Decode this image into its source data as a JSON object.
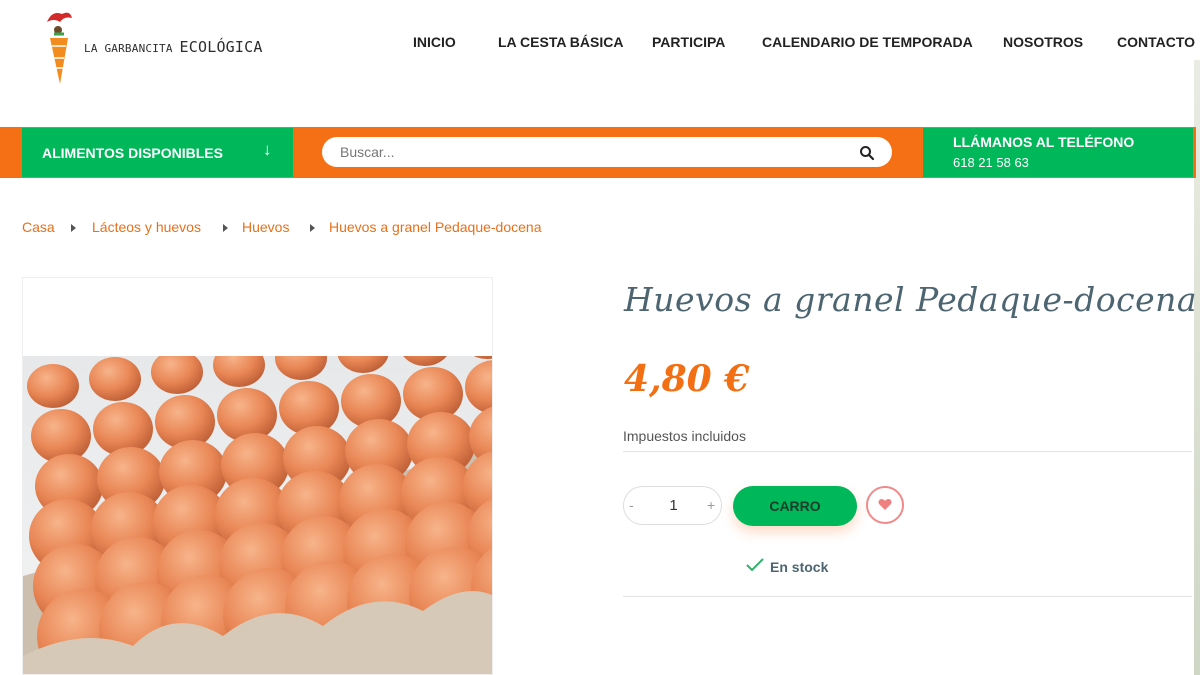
{
  "brand": {
    "line1": "LA GARBANCITA",
    "line2": "ECOLÓGICA"
  },
  "nav": [
    "INICIO",
    "LA CESTA BÁSICA",
    "PARTICIPA",
    "CALENDARIO DE TEMPORADA",
    "NOSOTROS",
    "CONTACTO"
  ],
  "category_button": {
    "label": "ALIMENTOS DISPONIBLES",
    "arrow": "↓"
  },
  "search": {
    "placeholder": "Buscar..."
  },
  "phone": {
    "title": "LLÁMANOS AL TELÉFONO",
    "number": "618 21 58 63"
  },
  "breadcrumb": [
    "Casa",
    "Lácteos y huevos",
    "Huevos",
    "Huevos a granel Pedaque-docena"
  ],
  "product": {
    "title": "Huevos a granel Pedaque-docena",
    "price": "4,80 €",
    "tax_note": "Impuestos incluidos",
    "quantity": "1",
    "qty_minus": "-",
    "qty_plus": "+",
    "cart_label": "CARRO",
    "stock": "En stock"
  },
  "colors": {
    "orange": "#f56f14",
    "green": "#00b75a",
    "title": "#4d6571"
  },
  "icons": [
    "carrot-logo-icon",
    "arrow-down-icon",
    "search-icon",
    "heart-icon",
    "check-icon"
  ]
}
